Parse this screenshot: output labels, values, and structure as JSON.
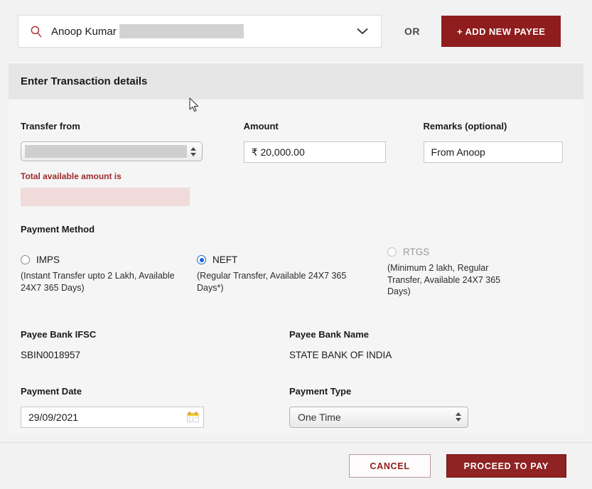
{
  "top_bar": {
    "search": {
      "icon": "search-icon",
      "value": "Anoop Kumar",
      "redacted": true,
      "dropdown_icon": "chevron-down-icon"
    },
    "or_label": "OR",
    "add_payee_label": "+ ADD NEW PAYEE"
  },
  "section": {
    "title": "Enter Transaction details"
  },
  "form": {
    "transfer_from": {
      "label": "Transfer from",
      "value": "",
      "redacted": true,
      "available_label": "Total available amount is",
      "available_value": "",
      "available_redacted": true
    },
    "amount": {
      "label": "Amount",
      "value": "₹ 20,000.00"
    },
    "remarks": {
      "label": "Remarks (optional)",
      "value": "From Anoop"
    },
    "payment_method": {
      "label": "Payment Method",
      "options": [
        {
          "id": "imps",
          "label": "IMPS",
          "description": "(Instant Transfer upto 2 Lakh, Available 24X7 365 Days)",
          "selected": false,
          "disabled": false
        },
        {
          "id": "neft",
          "label": "NEFT",
          "description": "(Regular Transfer, Available 24X7 365 Days*)",
          "selected": true,
          "disabled": false
        },
        {
          "id": "rtgs",
          "label": "RTGS",
          "description": "(Minimum 2 lakh, Regular Transfer, Available 24X7 365 Days)",
          "selected": false,
          "disabled": true
        }
      ]
    },
    "payee_bank_ifsc": {
      "label": "Payee Bank IFSC",
      "value": "SBIN0018957"
    },
    "payee_bank_name": {
      "label": "Payee Bank Name",
      "value": "STATE BANK OF INDIA"
    },
    "payment_date": {
      "label": "Payment Date",
      "value": "29/09/2021",
      "calendar_icon": "calendar-icon"
    },
    "payment_type": {
      "label": "Payment Type",
      "value": "One Time"
    }
  },
  "footer": {
    "cancel_label": "CANCEL",
    "proceed_label": "PROCEED TO PAY"
  },
  "colors": {
    "brand_red": "#8f1d1d",
    "accent_blue": "#1666d6",
    "warning_red": "#9c2b2b",
    "page_bg": "#f2f2f2",
    "panel_bg": "#f5f5f5",
    "header_bg": "#e6e6e6"
  }
}
